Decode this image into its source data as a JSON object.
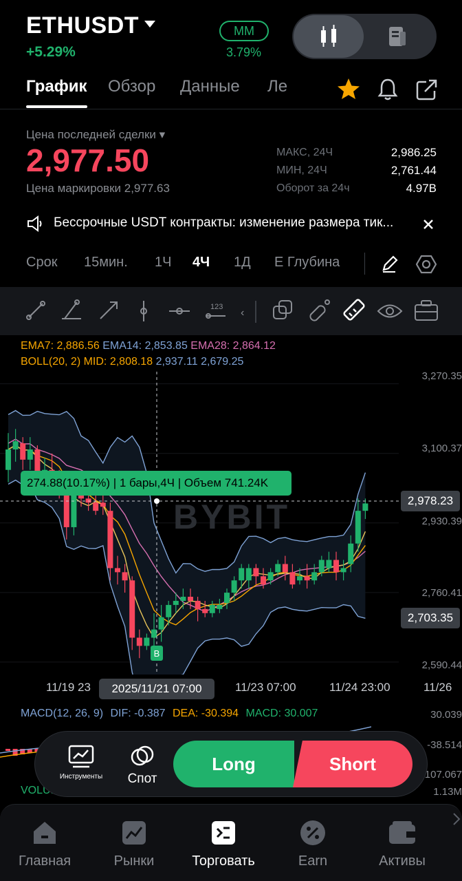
{
  "header": {
    "symbol": "ETHUSDT",
    "change": "+5.29%",
    "mm_label": "MM",
    "mm_value": "3.79%"
  },
  "tabs": [
    "График",
    "Обзор",
    "Данные",
    "Ле"
  ],
  "price": {
    "last_label": "Цена последней сделки",
    "last": "2,977.50",
    "mark_label": "Цена маркировки",
    "mark": "2,977.63",
    "stats": [
      {
        "k": "МАКС, 24Ч",
        "v": "2,986.25"
      },
      {
        "k": "МИН, 24Ч",
        "v": "2,761.44"
      },
      {
        "k": "Оборот за 24ч",
        "v": "4.97B"
      }
    ]
  },
  "notice": "Бессрочные USDT контракты: изменение размера тик...",
  "timeframes": [
    "Срок",
    "15мин.",
    "1Ч",
    "4Ч",
    "1Д",
    "Е Глубина"
  ],
  "active_timeframe": "4Ч",
  "indicators": {
    "ema7": "EMA7: 2,886.56",
    "ema14": "EMA14: 2,853.85",
    "ema28": "EMA28: 2,864.12",
    "boll_mid": "BOLL(20, 2) MID: 2,808.18",
    "boll_up_dn": "2,937.11 2,679.25"
  },
  "yaxis": [
    "3,270.35",
    "3,100.37",
    "2,930.39",
    "2,760.41",
    "2,590.44"
  ],
  "price_tags": {
    "current": "2,978.23",
    "cursor": "2,703.35"
  },
  "xaxis": [
    "11/19 23",
    "11/23 07:00",
    "11/24 23:00",
    "11/26"
  ],
  "cursor_time": "2025/11/21 07:00",
  "tooltip": "274.88(10.17%) | 1 бары,4Ч | Объем 741.24K",
  "watermark": "BYBIT",
  "buy_marker": "B",
  "macd": {
    "label": "MACD(12, 26, 9)",
    "dif": "DIF: -0.387",
    "dea": "DEA: -30.394",
    "macd": "MACD: 30.007",
    "axis": [
      "30.039",
      "-38.514",
      "-107.067"
    ]
  },
  "volume": {
    "label": "VOLUME",
    "axis": "1.13M"
  },
  "dock": {
    "tools": "Инструменты",
    "spot": "Спот",
    "long": "Long",
    "short": "Short"
  },
  "nav": [
    "Главная",
    "Рынки",
    "Торговать",
    "Earn",
    "Активы"
  ],
  "colors": {
    "up": "#20b26c",
    "down": "#f6465d",
    "accent": "#f7a600"
  },
  "chart_data": {
    "type": "candlestick",
    "interval": "4Ч",
    "candles": [
      {
        "o": 3060,
        "c": 3110,
        "l": 3030,
        "h": 3150
      },
      {
        "o": 3110,
        "c": 3130,
        "l": 3080,
        "h": 3160
      },
      {
        "o": 3125,
        "c": 3085,
        "l": 3060,
        "h": 3140
      },
      {
        "o": 3085,
        "c": 3110,
        "l": 3060,
        "h": 3140
      },
      {
        "o": 3110,
        "c": 3040,
        "l": 3020,
        "h": 3120
      },
      {
        "o": 3040,
        "c": 3060,
        "l": 3010,
        "h": 3090
      },
      {
        "o": 3060,
        "c": 3040,
        "l": 3030,
        "h": 3100
      },
      {
        "o": 3050,
        "c": 3010,
        "l": 2990,
        "h": 3060
      },
      {
        "o": 3010,
        "c": 2920,
        "l": 2890,
        "h": 3020
      },
      {
        "o": 2920,
        "c": 3000,
        "l": 2900,
        "h": 3020
      },
      {
        "o": 3000,
        "c": 2990,
        "l": 2970,
        "h": 3040
      },
      {
        "o": 2990,
        "c": 2980,
        "l": 2960,
        "h": 3010
      },
      {
        "o": 2980,
        "c": 2960,
        "l": 2950,
        "h": 3000
      },
      {
        "o": 2980,
        "c": 2970,
        "l": 2950,
        "h": 3010
      },
      {
        "o": 2960,
        "c": 2820,
        "l": 2790,
        "h": 2980
      },
      {
        "o": 2820,
        "c": 2810,
        "l": 2780,
        "h": 2850
      },
      {
        "o": 2810,
        "c": 2790,
        "l": 2760,
        "h": 2830
      },
      {
        "o": 2790,
        "c": 2650,
        "l": 2620,
        "h": 2800
      },
      {
        "o": 2650,
        "c": 2630,
        "l": 2600,
        "h": 2670
      },
      {
        "o": 2630,
        "c": 2650,
        "l": 2620,
        "h": 2660
      },
      {
        "o": 2650,
        "c": 2670,
        "l": 2600,
        "h": 2710
      },
      {
        "o": 2670,
        "c": 2700,
        "l": 2640,
        "h": 2730
      },
      {
        "o": 2700,
        "c": 2730,
        "l": 2680,
        "h": 2740
      },
      {
        "o": 2730,
        "c": 2740,
        "l": 2710,
        "h": 2760
      },
      {
        "o": 2740,
        "c": 2750,
        "l": 2720,
        "h": 2770
      },
      {
        "o": 2750,
        "c": 2740,
        "l": 2720,
        "h": 2770
      },
      {
        "o": 2740,
        "c": 2720,
        "l": 2690,
        "h": 2750
      },
      {
        "o": 2720,
        "c": 2710,
        "l": 2700,
        "h": 2740
      },
      {
        "o": 2710,
        "c": 2730,
        "l": 2700,
        "h": 2740
      },
      {
        "o": 2720,
        "c": 2730,
        "l": 2710,
        "h": 2745
      },
      {
        "o": 2735,
        "c": 2760,
        "l": 2720,
        "h": 2770
      },
      {
        "o": 2760,
        "c": 2790,
        "l": 2740,
        "h": 2800
      },
      {
        "o": 2790,
        "c": 2820,
        "l": 2770,
        "h": 2830
      },
      {
        "o": 2790,
        "c": 2820,
        "l": 2770,
        "h": 2830
      },
      {
        "o": 2820,
        "c": 2800,
        "l": 2780,
        "h": 2830
      },
      {
        "o": 2800,
        "c": 2780,
        "l": 2770,
        "h": 2820
      },
      {
        "o": 2790,
        "c": 2810,
        "l": 2780,
        "h": 2820
      },
      {
        "o": 2810,
        "c": 2830,
        "l": 2800,
        "h": 2840
      },
      {
        "o": 2830,
        "c": 2810,
        "l": 2790,
        "h": 2850
      },
      {
        "o": 2810,
        "c": 2780,
        "l": 2770,
        "h": 2830
      },
      {
        "o": 2790,
        "c": 2800,
        "l": 2780,
        "h": 2820
      },
      {
        "o": 2800,
        "c": 2790,
        "l": 2770,
        "h": 2830
      },
      {
        "o": 2790,
        "c": 2810,
        "l": 2780,
        "h": 2830
      },
      {
        "o": 2810,
        "c": 2840,
        "l": 2800,
        "h": 2850
      },
      {
        "o": 2820,
        "c": 2840,
        "l": 2810,
        "h": 2860
      },
      {
        "o": 2840,
        "c": 2810,
        "l": 2790,
        "h": 2860
      },
      {
        "o": 2810,
        "c": 2820,
        "l": 2790,
        "h": 2840
      },
      {
        "o": 2830,
        "c": 2880,
        "l": 2810,
        "h": 2900
      },
      {
        "o": 2880,
        "c": 2960,
        "l": 2860,
        "h": 2990
      },
      {
        "o": 2960,
        "c": 2978,
        "l": 2940,
        "h": 2990
      }
    ],
    "ylim": [
      2560,
      3300
    ],
    "yticks": [
      3270.35,
      3100.37,
      2930.39,
      2760.41,
      2590.44
    ]
  }
}
